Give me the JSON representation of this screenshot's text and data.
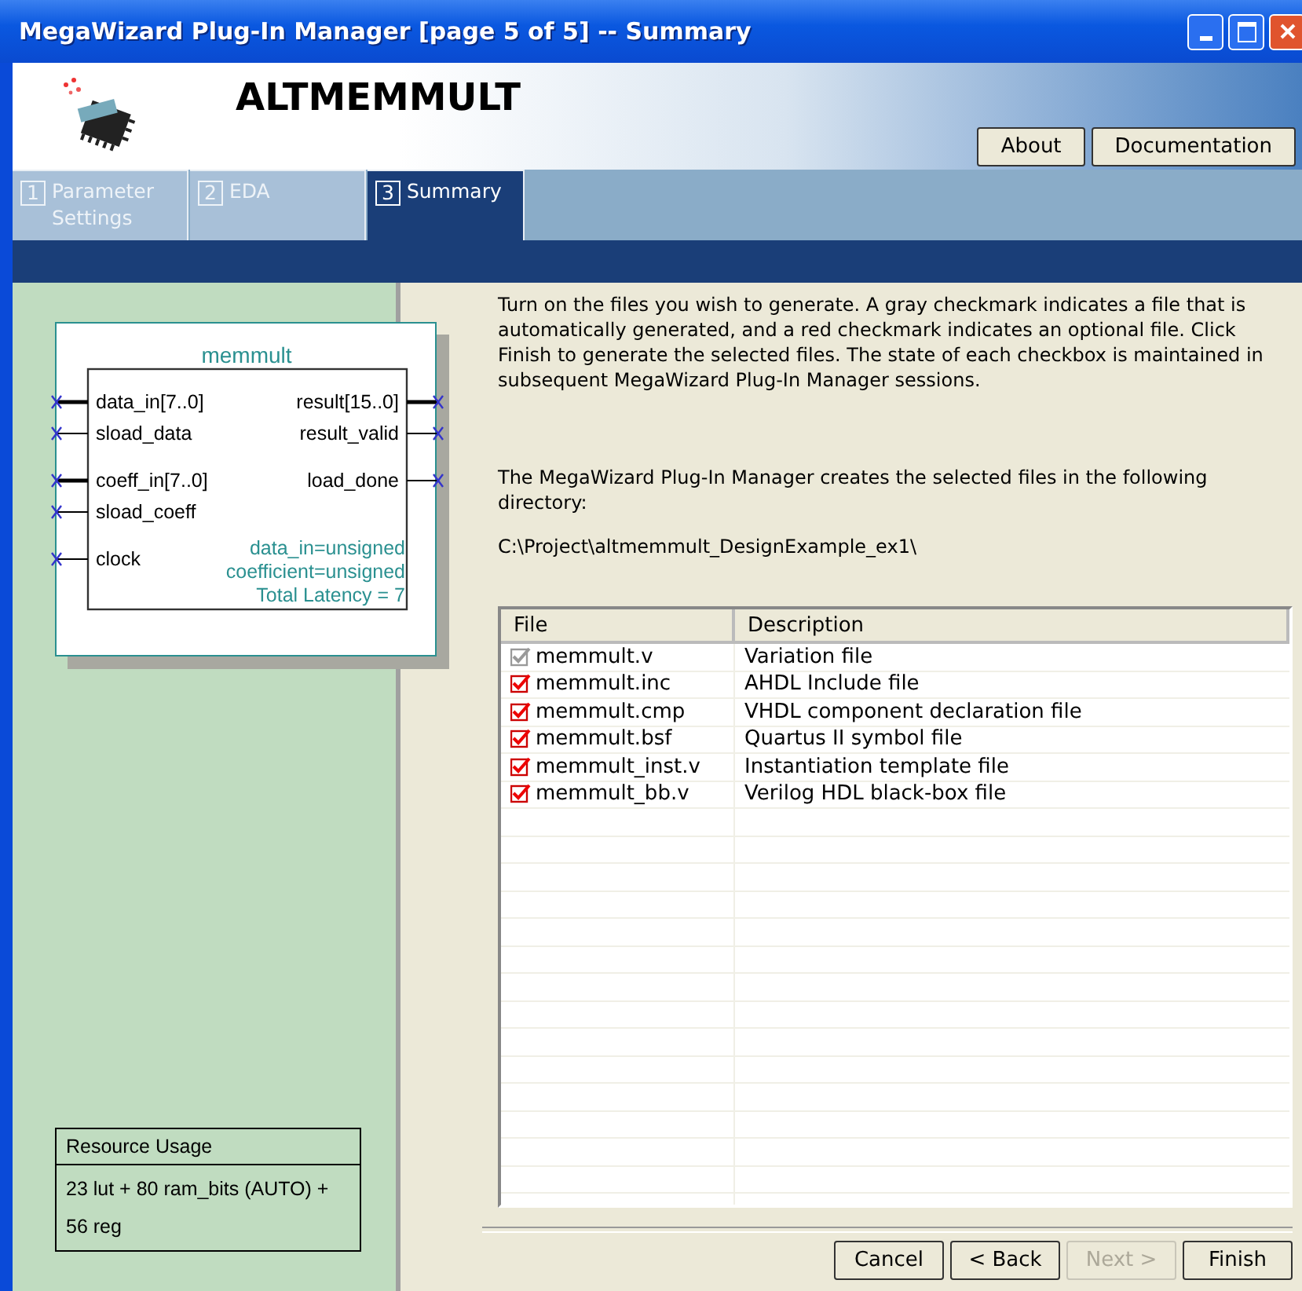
{
  "window": {
    "title": "MegaWizard Plug-In Manager [page 5 of 5] -- Summary"
  },
  "header": {
    "title": "ALTMEMMULT",
    "buttons": [
      {
        "label": "About"
      },
      {
        "label": "Documentation"
      }
    ]
  },
  "tabs": [
    {
      "number": "1",
      "label": "Parameter Settings",
      "selected": false
    },
    {
      "number": "2",
      "label": "EDA",
      "selected": false
    },
    {
      "number": "3",
      "label": "Summary",
      "selected": true
    }
  ],
  "symbol": {
    "name": "memmult",
    "inputs": [
      {
        "name": "data_in[7..0]",
        "bus": true
      },
      {
        "name": "sload_data",
        "bus": false
      },
      {
        "name": "coeff_in[7..0]",
        "bus": true
      },
      {
        "name": "sload_coeff",
        "bus": false
      },
      {
        "name": "clock",
        "bus": false
      }
    ],
    "outputs": [
      {
        "name": "result[15..0]",
        "bus": true
      },
      {
        "name": "result_valid",
        "bus": false
      },
      {
        "name": "load_done",
        "bus": false
      }
    ],
    "notes": [
      "data_in=unsigned",
      "coefficient=unsigned",
      "Total Latency = 7"
    ]
  },
  "resource_usage": {
    "title": "Resource Usage",
    "value": "23 lut + 80 ram_bits (AUTO) + 56 reg"
  },
  "instructions": "Turn on the files you wish to generate. A gray checkmark indicates a file that is automatically generated, and a red checkmark indicates an optional file. Click Finish to generate the selected files. The state of each checkbox is maintained in subsequent MegaWizard Plug-In Manager sessions.",
  "directory_note": "The MegaWizard Plug-In Manager creates the selected files in the following directory:",
  "directory": "C:\\Project\\altmemmult_DesignExample_ex1\\",
  "table": {
    "columns": [
      "File",
      "Description"
    ],
    "rows": [
      {
        "file": "memmult.v",
        "description": "Variation file",
        "checked": true,
        "kind": "auto"
      },
      {
        "file": "memmult.inc",
        "description": "AHDL Include file",
        "checked": true,
        "kind": "optional"
      },
      {
        "file": "memmult.cmp",
        "description": "VHDL component declaration file",
        "checked": true,
        "kind": "optional"
      },
      {
        "file": "memmult.bsf",
        "description": "Quartus II symbol file",
        "checked": true,
        "kind": "optional"
      },
      {
        "file": "memmult_inst.v",
        "description": "Instantiation template file",
        "checked": true,
        "kind": "optional"
      },
      {
        "file": "memmult_bb.v",
        "description": "Verilog HDL black-box file",
        "checked": true,
        "kind": "optional"
      }
    ]
  },
  "buttons": [
    {
      "label": "Cancel",
      "disabled": false
    },
    {
      "label": "< Back",
      "disabled": false
    },
    {
      "label": "Next >",
      "disabled": true
    },
    {
      "label": "Finish",
      "disabled": false
    }
  ]
}
